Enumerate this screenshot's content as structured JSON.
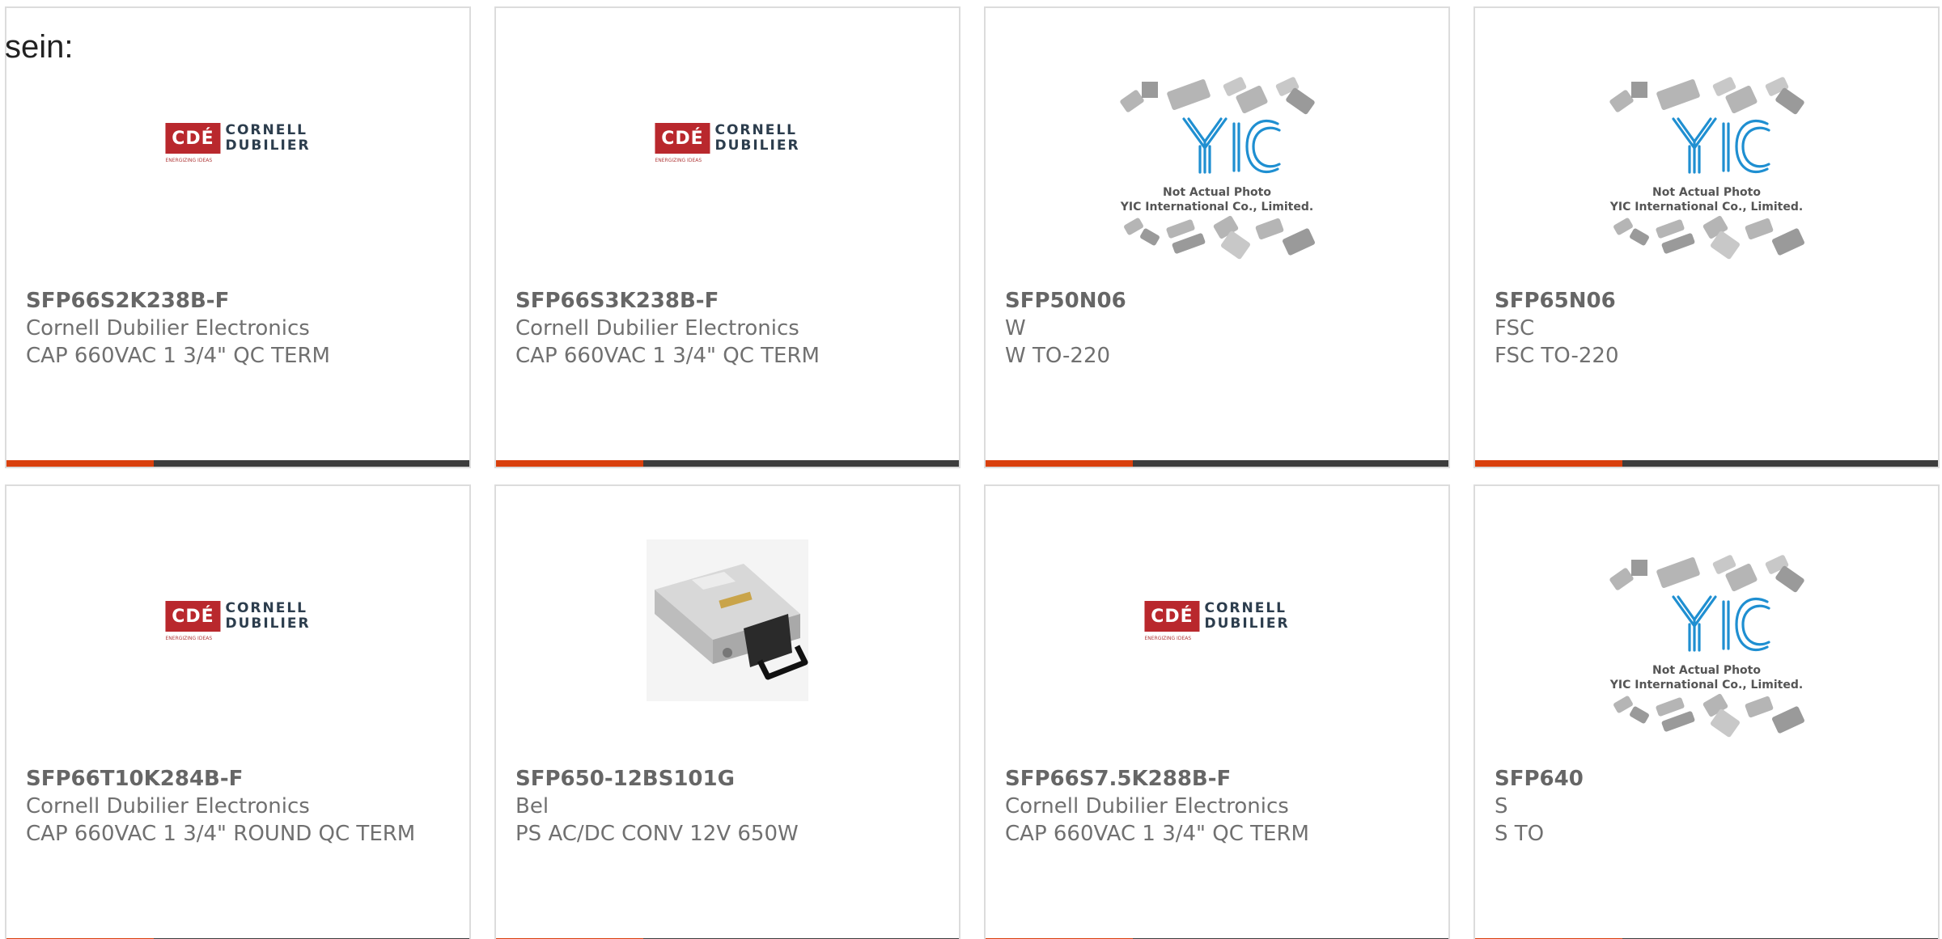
{
  "page": {
    "lead_text": "sein:"
  },
  "colors": {
    "accent_bar": "#d9400d",
    "bar_rest": "#3d3d3d",
    "cde_red": "#b9282d",
    "yic_blue": "#1f8fd1"
  },
  "logos": {
    "cde": {
      "mark": "CDÉ",
      "word1": "CORNELL",
      "word2": "DUBILIER",
      "tagline": "ENERGIZING IDEAS"
    },
    "yic": {
      "line1": "Not Actual Photo",
      "line2": "YIC International Co., Limited."
    }
  },
  "products": [
    {
      "part_number": "SFP66S2K238B-F",
      "manufacturer": "Cornell Dubilier Electronics",
      "description": "CAP 660VAC 1 3/4\" QC TERM",
      "image": "cde-logo"
    },
    {
      "part_number": "SFP66S3K238B-F",
      "manufacturer": "Cornell Dubilier Electronics",
      "description": "CAP 660VAC 1 3/4\" QC TERM",
      "image": "cde-logo"
    },
    {
      "part_number": "SFP50N06",
      "manufacturer": "W",
      "description": "W TO-220",
      "image": "yic-placeholder"
    },
    {
      "part_number": "SFP65N06",
      "manufacturer": "FSC",
      "description": "FSC TO-220",
      "image": "yic-placeholder"
    },
    {
      "part_number": "SFP66T10K284B-F",
      "manufacturer": "Cornell Dubilier Electronics",
      "description": "CAP 660VAC 1 3/4\" ROUND QC TERM",
      "image": "cde-logo"
    },
    {
      "part_number": "SFP650-12BS101G",
      "manufacturer": "Bel",
      "description": "PS AC/DC CONV 12V 650W",
      "image": "power-supply-photo"
    },
    {
      "part_number": "SFP66S7.5K288B-F",
      "manufacturer": "Cornell Dubilier Electronics",
      "description": "CAP 660VAC 1 3/4\" QC TERM",
      "image": "cde-logo"
    },
    {
      "part_number": "SFP640",
      "manufacturer": "S",
      "description": "S TO",
      "image": "yic-placeholder"
    }
  ]
}
